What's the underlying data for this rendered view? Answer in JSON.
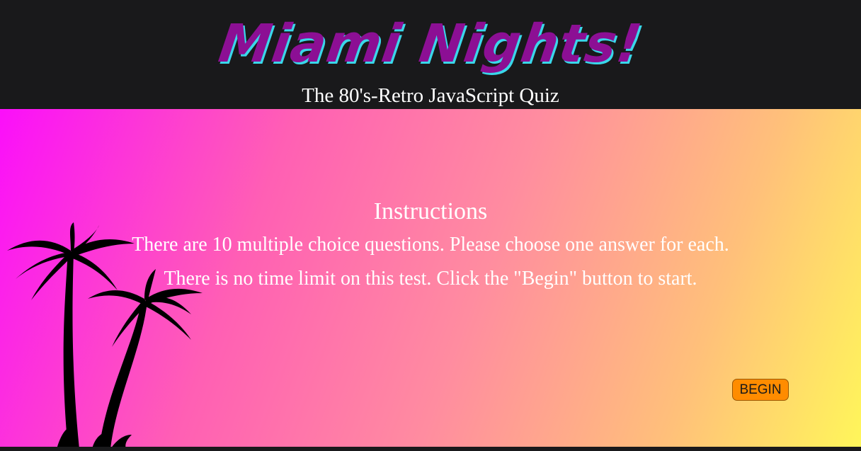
{
  "header": {
    "logo_text": "Miami Nights!",
    "subtitle": "The 80's-Retro JavaScript Quiz"
  },
  "instructions": {
    "title": "Instructions",
    "line1": "There are 10 multiple choice questions. Please choose one answer for each.",
    "line2": "There is no time limit on this test. Click the \"Begin\" button to start."
  },
  "actions": {
    "begin_label": "BEGIN"
  },
  "colors": {
    "header_bg": "#19191b",
    "logo": "#8c0f94",
    "logo_shadow": "#3ad7ea",
    "gradient_start": "#fb0ffa",
    "gradient_end": "#fff65a",
    "button": "#ff8c00"
  },
  "decoration": {
    "image": "palm-trees-silhouette"
  }
}
